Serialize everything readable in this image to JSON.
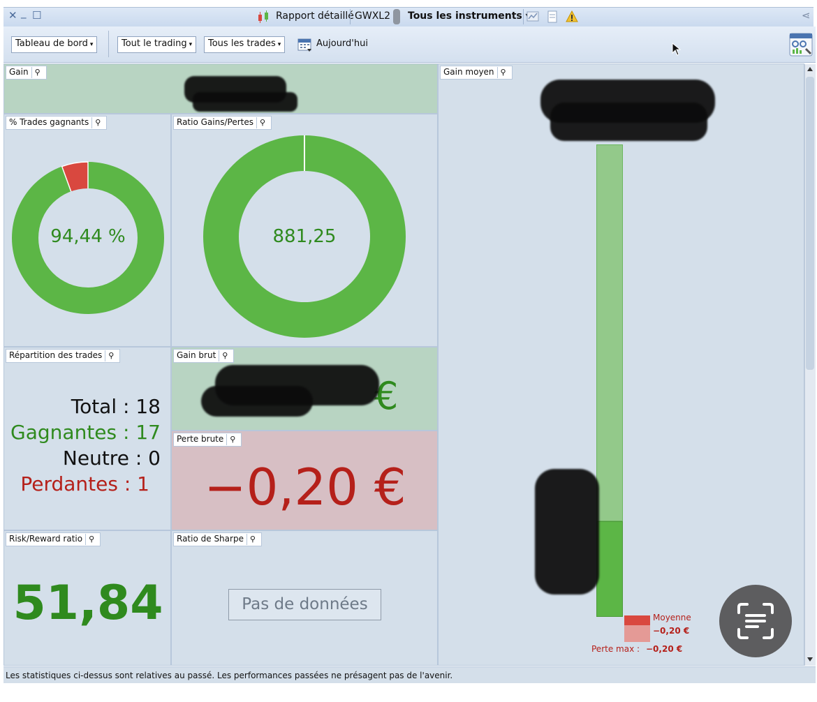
{
  "titlebar": {
    "close_glyph": "✕",
    "minimize_glyph": "_",
    "maximize_glyph": "☐",
    "report_label": "Rapport détaillé",
    "account_label": "GWXL2",
    "instruments_label": "Tous les instruments ▾",
    "share_glyph": "⋖"
  },
  "toolbar": {
    "dashboard_label": "Tableau de bord",
    "trading_label": "Tout le trading",
    "trades_label": "Tous les trades",
    "date_label": "Aujourd'hui",
    "dropdown_arrow": "▾"
  },
  "panels": {
    "gain": {
      "title": "Gain"
    },
    "win_trades": {
      "title": "% Trades gagnants",
      "value": "94,44 %",
      "win_fraction": 0.9444
    },
    "ratio": {
      "title": "Ratio Gains/Pertes",
      "value": "881,25",
      "gain_fraction": 0.9989
    },
    "avg_gain": {
      "title": "Gain moyen",
      "legend_label": "Moyenne",
      "legend_value": "−0,20 €",
      "max_loss_label": "Perte max :",
      "max_loss_value": "−0,20 €"
    },
    "distribution": {
      "title": "Répartition des trades",
      "total_label": "Total :",
      "total_value": "18",
      "win_label": "Gagnantes :",
      "win_value": "17",
      "neutral_label": "Neutre :",
      "neutral_value": "0",
      "loss_label": "Perdantes :",
      "loss_value": "1"
    },
    "gross_gain": {
      "title": "Gain brut",
      "visible_suffix": "€"
    },
    "gross_loss": {
      "title": "Perte brute",
      "value": "−0,20 €"
    },
    "risk_reward": {
      "title": "Risk/Reward ratio",
      "value": "51,84"
    },
    "sharpe": {
      "title": "Ratio de Sharpe",
      "no_data_label": "Pas de données"
    }
  },
  "footer": {
    "disclaimer": "Les statistiques ci-dessus sont relatives au passé. Les performances passées ne présagent pas de l'avenir."
  },
  "colors": {
    "gain_green": "#5cb646",
    "text_green": "#2f8a1e",
    "loss_red": "#d9483f",
    "text_red": "#b5201a",
    "panel_blue": "#d4dfea"
  }
}
